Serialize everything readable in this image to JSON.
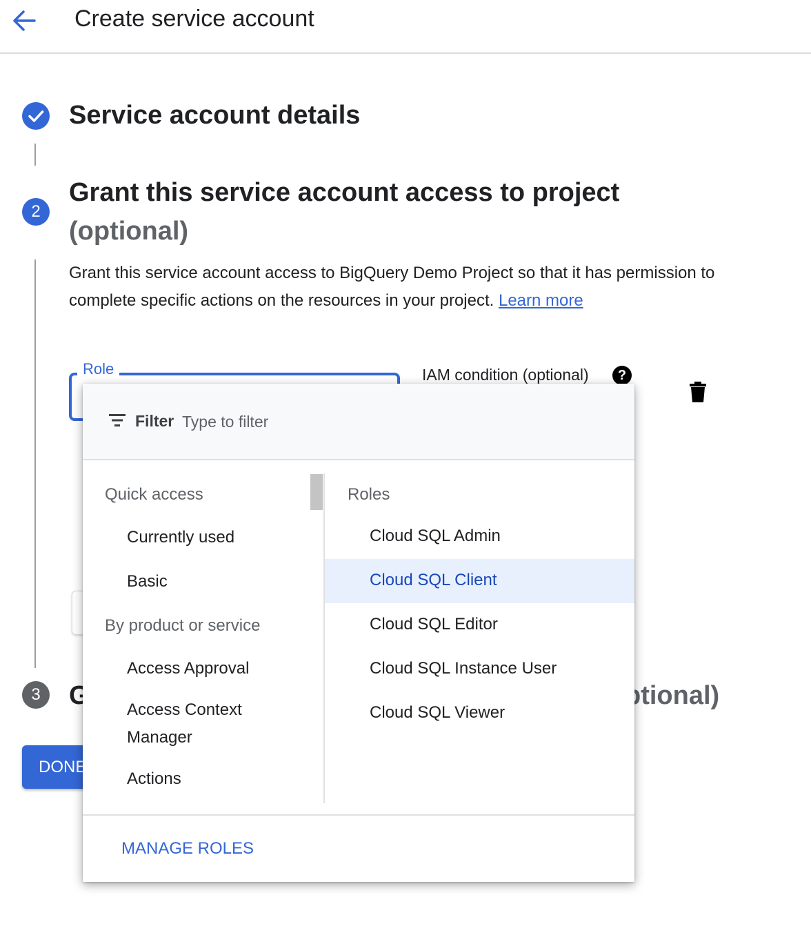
{
  "header": {
    "title": "Create service account"
  },
  "steps": [
    {
      "number": "",
      "title": "Service account details",
      "state": "done"
    },
    {
      "number": "2",
      "title": "Grant this service account access to project",
      "optional_label": "(optional)",
      "state": "active"
    },
    {
      "number": "3",
      "title_prefix": "G",
      "optional_tail": "ptional)",
      "state": "pending"
    }
  ],
  "step2": {
    "description": "Grant this service account access to BigQuery Demo Project so that it has permission to complete specific actions on the resources in your project.",
    "learn_more": "Learn more",
    "role_label": "Role",
    "iam_condition_label": "IAM condition (optional)",
    "help_glyph": "?"
  },
  "done_button": "DONE",
  "menu": {
    "filter_label": "Filter",
    "filter_placeholder": "Type to filter",
    "left": {
      "quick_access_header": "Quick access",
      "quick_access_items": [
        "Currently used",
        "Basic"
      ],
      "by_product_header": "By product or service",
      "by_product_items": [
        "Access Approval",
        "Access Context Manager",
        "Actions"
      ]
    },
    "right": {
      "header": "Roles",
      "roles": [
        "Cloud SQL Admin",
        "Cloud SQL Client",
        "Cloud SQL Editor",
        "Cloud SQL Instance User",
        "Cloud SQL Viewer"
      ],
      "selected_role": "Cloud SQL Client"
    },
    "manage_roles": "MANAGE ROLES"
  },
  "colors": {
    "accent": "#3367d6",
    "selected_bg": "#e8f0fe",
    "pending_step": "#5f6368"
  },
  "icons": {
    "back": "arrow-back-icon",
    "check": "check-icon",
    "filter": "filter-list-icon",
    "help": "help-icon",
    "delete": "trash-icon"
  }
}
